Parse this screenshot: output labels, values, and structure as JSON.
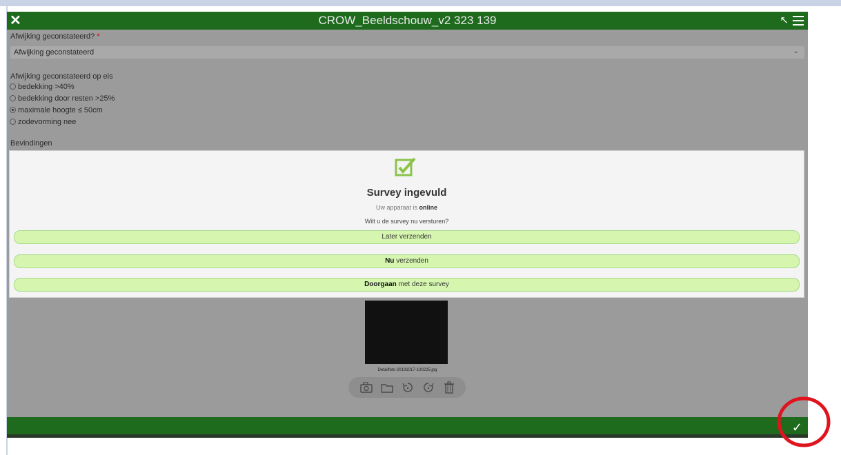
{
  "app": {
    "title": "CROW_Beeldschouw_v2 323 139",
    "close_glyph": "✕",
    "tools_glyph": "↖"
  },
  "form": {
    "deviation_label": "Afwijking geconstateerd?",
    "required_mark": "*",
    "deviation_value": "Afwijking geconstateerd",
    "chevron_glyph": "⌄",
    "requirement_label": "Afwijking geconstateerd op eis",
    "options": [
      {
        "label": "bedekking >40%",
        "selected": false
      },
      {
        "label": "bedekking door resten >25%",
        "selected": false
      },
      {
        "label": "maximale hoogte ≤ 50cm",
        "selected": true
      },
      {
        "label": "zodevorming nee",
        "selected": false
      }
    ],
    "findings_label": "Bevindingen"
  },
  "dialog": {
    "title": "Survey ingevuld",
    "status_prefix": "Uw apparaat is",
    "status_value": "online",
    "question": "Wilt u de survey nu versturen?",
    "later_label": "Later verzenden",
    "now_bold": "Nu",
    "now_rest": "verzenden",
    "continue_bold": "Doorgaan",
    "continue_rest": "met deze survey"
  },
  "attachment": {
    "filename": "Detailfoto-20191017-100225.jpg"
  },
  "toolbar": {
    "check_glyph": "✓"
  },
  "colors": {
    "header_green": "#1e6b1e",
    "button_green": "#d6f6b0",
    "highlight_red": "#e0141e"
  }
}
